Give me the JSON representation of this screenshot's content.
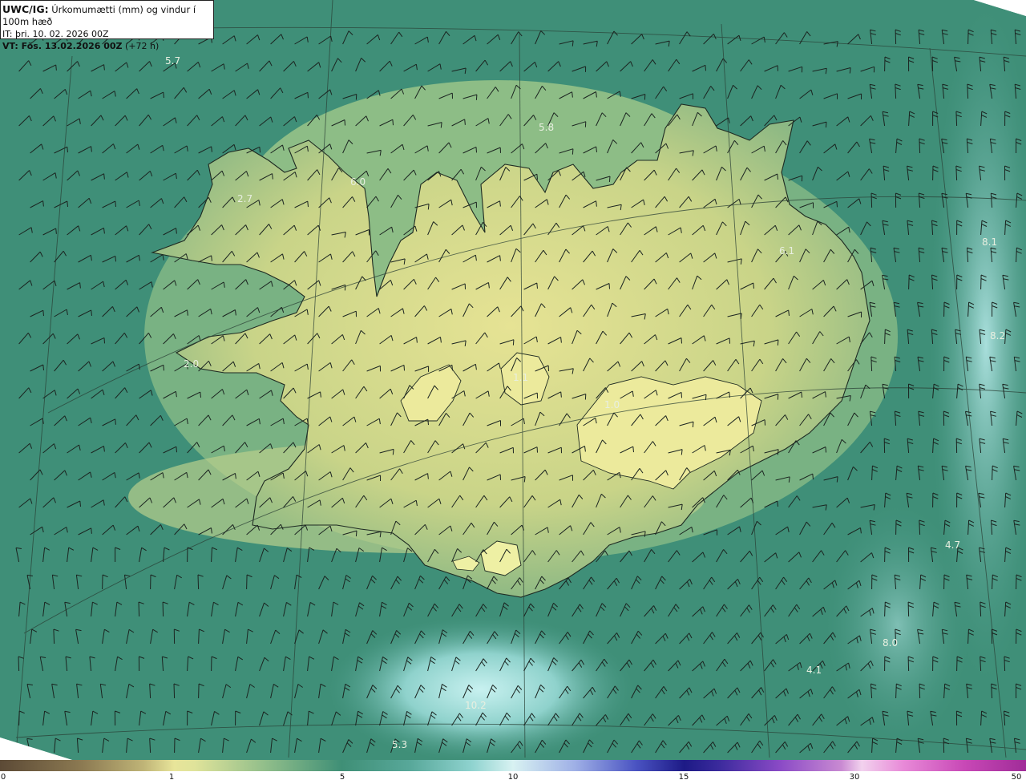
{
  "header": {
    "model_label": "UWC/IG:",
    "title": "Úrkomumætti (mm) og vindur í 100m hæð",
    "init_time": "IT: þri. 10. 02. 2026 00Z",
    "valid_label": "VT: Fös. 13.02.2026 00Z",
    "lead_time": "(+72 h)"
  },
  "map_values": [
    {
      "text": "5.7"
    },
    {
      "text": "5.8"
    },
    {
      "text": "6.0"
    },
    {
      "text": "2.7"
    },
    {
      "text": "6.1"
    },
    {
      "text": "8.1"
    },
    {
      "text": "8.2"
    },
    {
      "text": "2.0"
    },
    {
      "text": "1.1"
    },
    {
      "text": "1.0"
    },
    {
      "text": "4.7"
    },
    {
      "text": "8.0"
    },
    {
      "text": "4.1"
    },
    {
      "text": "10.2"
    },
    {
      "text": "5.3"
    }
  ],
  "colorbar": {
    "ticks": [
      "0",
      "1",
      "5",
      "10",
      "15",
      "30",
      "50"
    ]
  },
  "colors": {
    "dry": "#5c4a36",
    "light": "#e8e59a",
    "moderate": "#3f8f76",
    "wet": "#d8f2f2",
    "heavy": "#1d1a86",
    "extreme": "#a02c98"
  }
}
